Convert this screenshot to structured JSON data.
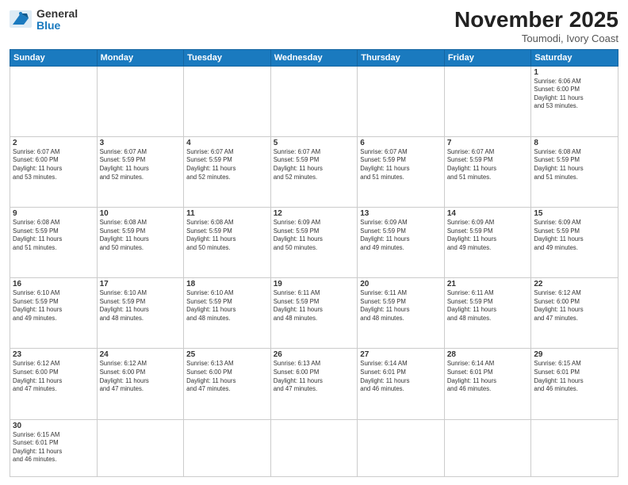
{
  "header": {
    "logo_line1": "General",
    "logo_line2": "Blue",
    "month_title": "November 2025",
    "subtitle": "Toumodi, Ivory Coast"
  },
  "weekdays": [
    "Sunday",
    "Monday",
    "Tuesday",
    "Wednesday",
    "Thursday",
    "Friday",
    "Saturday"
  ],
  "weeks": [
    [
      {
        "day": "",
        "info": ""
      },
      {
        "day": "",
        "info": ""
      },
      {
        "day": "",
        "info": ""
      },
      {
        "day": "",
        "info": ""
      },
      {
        "day": "",
        "info": ""
      },
      {
        "day": "",
        "info": ""
      },
      {
        "day": "1",
        "info": "Sunrise: 6:06 AM\nSunset: 6:00 PM\nDaylight: 11 hours\nand 53 minutes."
      }
    ],
    [
      {
        "day": "2",
        "info": "Sunrise: 6:07 AM\nSunset: 6:00 PM\nDaylight: 11 hours\nand 53 minutes."
      },
      {
        "day": "3",
        "info": "Sunrise: 6:07 AM\nSunset: 5:59 PM\nDaylight: 11 hours\nand 52 minutes."
      },
      {
        "day": "4",
        "info": "Sunrise: 6:07 AM\nSunset: 5:59 PM\nDaylight: 11 hours\nand 52 minutes."
      },
      {
        "day": "5",
        "info": "Sunrise: 6:07 AM\nSunset: 5:59 PM\nDaylight: 11 hours\nand 52 minutes."
      },
      {
        "day": "6",
        "info": "Sunrise: 6:07 AM\nSunset: 5:59 PM\nDaylight: 11 hours\nand 51 minutes."
      },
      {
        "day": "7",
        "info": "Sunrise: 6:07 AM\nSunset: 5:59 PM\nDaylight: 11 hours\nand 51 minutes."
      },
      {
        "day": "8",
        "info": "Sunrise: 6:08 AM\nSunset: 5:59 PM\nDaylight: 11 hours\nand 51 minutes."
      }
    ],
    [
      {
        "day": "9",
        "info": "Sunrise: 6:08 AM\nSunset: 5:59 PM\nDaylight: 11 hours\nand 51 minutes."
      },
      {
        "day": "10",
        "info": "Sunrise: 6:08 AM\nSunset: 5:59 PM\nDaylight: 11 hours\nand 50 minutes."
      },
      {
        "day": "11",
        "info": "Sunrise: 6:08 AM\nSunset: 5:59 PM\nDaylight: 11 hours\nand 50 minutes."
      },
      {
        "day": "12",
        "info": "Sunrise: 6:09 AM\nSunset: 5:59 PM\nDaylight: 11 hours\nand 50 minutes."
      },
      {
        "day": "13",
        "info": "Sunrise: 6:09 AM\nSunset: 5:59 PM\nDaylight: 11 hours\nand 49 minutes."
      },
      {
        "day": "14",
        "info": "Sunrise: 6:09 AM\nSunset: 5:59 PM\nDaylight: 11 hours\nand 49 minutes."
      },
      {
        "day": "15",
        "info": "Sunrise: 6:09 AM\nSunset: 5:59 PM\nDaylight: 11 hours\nand 49 minutes."
      }
    ],
    [
      {
        "day": "16",
        "info": "Sunrise: 6:10 AM\nSunset: 5:59 PM\nDaylight: 11 hours\nand 49 minutes."
      },
      {
        "day": "17",
        "info": "Sunrise: 6:10 AM\nSunset: 5:59 PM\nDaylight: 11 hours\nand 48 minutes."
      },
      {
        "day": "18",
        "info": "Sunrise: 6:10 AM\nSunset: 5:59 PM\nDaylight: 11 hours\nand 48 minutes."
      },
      {
        "day": "19",
        "info": "Sunrise: 6:11 AM\nSunset: 5:59 PM\nDaylight: 11 hours\nand 48 minutes."
      },
      {
        "day": "20",
        "info": "Sunrise: 6:11 AM\nSunset: 5:59 PM\nDaylight: 11 hours\nand 48 minutes."
      },
      {
        "day": "21",
        "info": "Sunrise: 6:11 AM\nSunset: 5:59 PM\nDaylight: 11 hours\nand 48 minutes."
      },
      {
        "day": "22",
        "info": "Sunrise: 6:12 AM\nSunset: 6:00 PM\nDaylight: 11 hours\nand 47 minutes."
      }
    ],
    [
      {
        "day": "23",
        "info": "Sunrise: 6:12 AM\nSunset: 6:00 PM\nDaylight: 11 hours\nand 47 minutes."
      },
      {
        "day": "24",
        "info": "Sunrise: 6:12 AM\nSunset: 6:00 PM\nDaylight: 11 hours\nand 47 minutes."
      },
      {
        "day": "25",
        "info": "Sunrise: 6:13 AM\nSunset: 6:00 PM\nDaylight: 11 hours\nand 47 minutes."
      },
      {
        "day": "26",
        "info": "Sunrise: 6:13 AM\nSunset: 6:00 PM\nDaylight: 11 hours\nand 47 minutes."
      },
      {
        "day": "27",
        "info": "Sunrise: 6:14 AM\nSunset: 6:01 PM\nDaylight: 11 hours\nand 46 minutes."
      },
      {
        "day": "28",
        "info": "Sunrise: 6:14 AM\nSunset: 6:01 PM\nDaylight: 11 hours\nand 46 minutes."
      },
      {
        "day": "29",
        "info": "Sunrise: 6:15 AM\nSunset: 6:01 PM\nDaylight: 11 hours\nand 46 minutes."
      }
    ],
    [
      {
        "day": "30",
        "info": "Sunrise: 6:15 AM\nSunset: 6:01 PM\nDaylight: 11 hours\nand 46 minutes."
      },
      {
        "day": "",
        "info": ""
      },
      {
        "day": "",
        "info": ""
      },
      {
        "day": "",
        "info": ""
      },
      {
        "day": "",
        "info": ""
      },
      {
        "day": "",
        "info": ""
      },
      {
        "day": "",
        "info": ""
      }
    ]
  ]
}
